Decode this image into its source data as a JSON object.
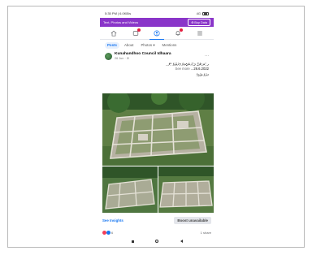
{
  "status_bar": {
    "time": "5:35 PM | 6.0KB/s",
    "network": "4G"
  },
  "promo_banner": {
    "text": "Text, Photos and Videos",
    "button_label": "Buy Data"
  },
  "page_tabs": {
    "posts": "Posts",
    "about": "About",
    "photos": "Photos ▾",
    "mentions": "Mentions"
  },
  "post": {
    "page_name": "Kunahandhoo Council Idhaara",
    "date": "26 Jun · ⊘",
    "caption_line1": "ގ.ކުނަހަންދޫ ޤަބުރުސްތާނަށް ފާރުލުމުގެ ކެރޭ...",
    "see_more": "See more",
    "caption_date": "...26.6.2022",
    "caption_line3": "ރަށުގެ މަގުތައް"
  },
  "actions": {
    "insights_label": "See Insights",
    "boost_label": "Boost unavailable"
  },
  "reactions": {
    "count": "6",
    "shares": "1 share"
  }
}
